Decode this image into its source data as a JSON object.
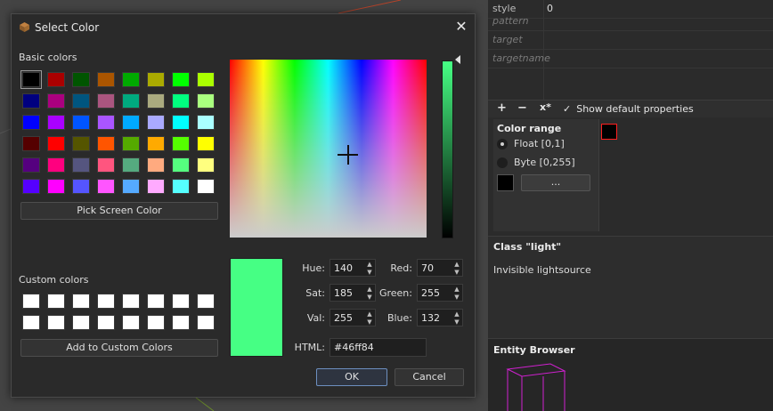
{
  "dialog": {
    "title": "Select Color",
    "basic_colors_label": "Basic colors",
    "basic_colors": [
      [
        "#000000",
        "#aa0000",
        "#005500",
        "#aa5500",
        "#00aa00",
        "#aaaa00",
        "#00ff00",
        "#aaff00"
      ],
      [
        "#00007f",
        "#aa007f",
        "#00557f",
        "#aa557f",
        "#00aa7f",
        "#aaaa7f",
        "#00ff7f",
        "#aaff7f"
      ],
      [
        "#0000ff",
        "#aa00ff",
        "#0055ff",
        "#aa55ff",
        "#00aaff",
        "#aaaaff",
        "#00ffff",
        "#aaffff"
      ],
      [
        "#550000",
        "#ff0000",
        "#555500",
        "#ff5500",
        "#55aa00",
        "#ffaa00",
        "#55ff00",
        "#ffff00"
      ],
      [
        "#55007f",
        "#ff007f",
        "#55557f",
        "#ff557f",
        "#55aa7f",
        "#ffaa7f",
        "#55ff7f",
        "#ffff7f"
      ],
      [
        "#5500ff",
        "#ff00ff",
        "#5555ff",
        "#ff55ff",
        "#55aaff",
        "#ffaaff",
        "#55ffff",
        "#ffffff"
      ]
    ],
    "pick_screen_color_label": "Pick Screen Color",
    "custom_colors_label": "Custom colors",
    "add_custom_label": "Add to Custom Colors",
    "hue_label": "Hue:",
    "hue_value": "140",
    "sat_label": "Sat:",
    "sat_value": "185",
    "val_label": "Val:",
    "val_value": "255",
    "red_label": "Red:",
    "red_value": "70",
    "green_label": "Green:",
    "green_value": "255",
    "blue_label": "Blue:",
    "blue_value": "132",
    "html_label": "HTML:",
    "html_value": "#46ff84",
    "current_color": "#46ff84",
    "ok_label": "OK",
    "cancel_label": "Cancel"
  },
  "properties": {
    "rows": [
      {
        "key": "style",
        "value": "0"
      },
      {
        "key": "pattern",
        "value": ""
      },
      {
        "key": "target",
        "value": ""
      },
      {
        "key": "targetname",
        "value": ""
      }
    ],
    "toolbar": {
      "add": "+",
      "remove": "−",
      "clear": "x*",
      "check": "✓",
      "show_default_label": "Show default properties"
    }
  },
  "color_range": {
    "title": "Color range",
    "float_label": "Float [0,1]",
    "byte_label": "Byte [0,255]",
    "dots_label": "..."
  },
  "class_info": {
    "title": "Class \"light\"",
    "description": "Invisible lightsource"
  },
  "entity_browser": {
    "title": "Entity Browser"
  }
}
